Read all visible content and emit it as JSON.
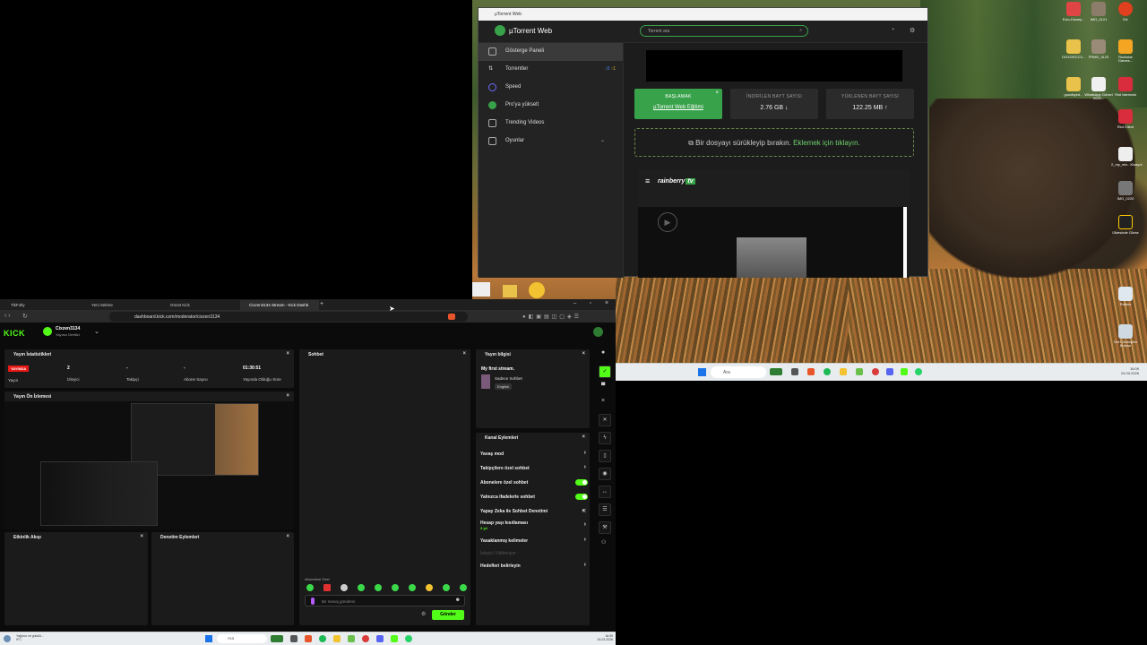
{
  "utorrent": {
    "title": "µTorrent Web",
    "brand": "µTorrent Web",
    "search_placeholder": "Torrent ara",
    "sidebar": [
      {
        "label": "Gösterge Paneli",
        "icon": "dashboard-icon"
      },
      {
        "label": "Torrentler",
        "icon": "torrent-icon",
        "badge_down": "0",
        "badge_up": "1"
      },
      {
        "label": "Speed",
        "icon": "speed-icon"
      },
      {
        "label": "Pro'ya yükselt",
        "icon": "pro-icon"
      },
      {
        "label": "Trending Videos",
        "icon": "video-icon"
      },
      {
        "label": "Oyunlar",
        "icon": "games-icon"
      }
    ],
    "start_card": {
      "title": "BAŞLAMAK",
      "link": "µTorrent Web Eğitimi"
    },
    "download_card": {
      "label": "İNDİRİLEN BAYT SAYISI",
      "value": "2.76 GB ↓"
    },
    "upload_card": {
      "label": "YÜKLENEN BAYT SAYISI",
      "value": "122.25 MB ↑"
    },
    "drop_text": "Bir dosyayı sürükleyip bırakın.",
    "drop_link": "Eklemek için tıklayın.",
    "rainberry": "rainberry",
    "rainberry_tv": "tv"
  },
  "desktop": {
    "icons": [
      "Ezio-Disney...",
      "IMG_0121",
      "EA",
      "OGXGRCC3...",
      "FRMS_3123",
      "Rockstar Games...",
      "goodbyed...",
      "WhatsApp Görsel 2025...",
      "Riot İstemcisi",
      "Riot Client",
      "2_my_mix...Kisayol",
      "IMG_0220",
      "Ülkesinde Görse",
      "Roblox",
      "Geri Dönüşüm Kutusu"
    ],
    "taskbar_search": "Ara",
    "clock_time": "16:09",
    "clock_date": "24.03.2026"
  },
  "browser": {
    "tabs": [
      "TikFolty",
      "Yeni Sekme",
      "Gözat Kick",
      "Cixzen3134 Stream - Kick Dashb"
    ],
    "url": "dashboard.kick.com/moderator/cixzen3134",
    "kick_logo": "KICK",
    "channel_name": "Cixzen3134",
    "channel_role": "Yayıncı Ürettici",
    "stream_stats": {
      "title": "Yayın İstatistikleri",
      "live_badge": "YAYINDA",
      "items": [
        {
          "value": "",
          "label": "Yayın"
        },
        {
          "value": "2",
          "label": "İzleyici"
        },
        {
          "value": "-",
          "label": "Takipçi"
        },
        {
          "value": "-",
          "label": "Abone Sayısı"
        },
        {
          "value": "01:30:51",
          "label": "Yayında Olduğu Süre"
        }
      ]
    },
    "preview_title": "Yayın Ön İzlemesi",
    "activity_title": "Etkinlik Akışı",
    "moderation_title": "Denetim Eylemleri",
    "chat": {
      "title": "Sohbet",
      "subs_label": "Abonelere Özel",
      "input_placeholder": "Bir mesaj gönderin",
      "send_label": "Gönder"
    },
    "stream_info": {
      "title": "Yayın bilgisi",
      "stream_title": "My first stream.",
      "category": "Sadece Sohbet",
      "language": "English"
    },
    "channel_actions": {
      "title": "Kanal Eylemleri",
      "rows": [
        {
          "label": "Yavaş mod",
          "type": "chevron"
        },
        {
          "label": "Takipçilere özel sohbet",
          "type": "chevron"
        },
        {
          "label": "Abonelere özel sohbet",
          "type": "toggle"
        },
        {
          "label": "Yalnızca ifadelerle sohbet",
          "type": "toggle"
        },
        {
          "label": "Yapay Zeka ile Sohbet Denetimi",
          "type": "external"
        },
        {
          "label": "Hesap yaşı kısıtlaması",
          "sub": "3 yıl",
          "type": "chevron"
        },
        {
          "label": "Yasaklanmış kelimeler",
          "type": "chevron"
        },
        {
          "label": "İzleyici Yükleniyor",
          "type": "muted"
        },
        {
          "label": "Hedefleri belirleyin",
          "type": "chevron"
        }
      ]
    }
  },
  "win_taskbar": {
    "weather": "Yağmur ve gücülü...",
    "weather_temp": "9°C",
    "search": "Ara",
    "time": "16:09",
    "date": "24.03.2026"
  },
  "colors": {
    "kick_green": "#53fc18",
    "utorrent_green": "#38a24a"
  }
}
